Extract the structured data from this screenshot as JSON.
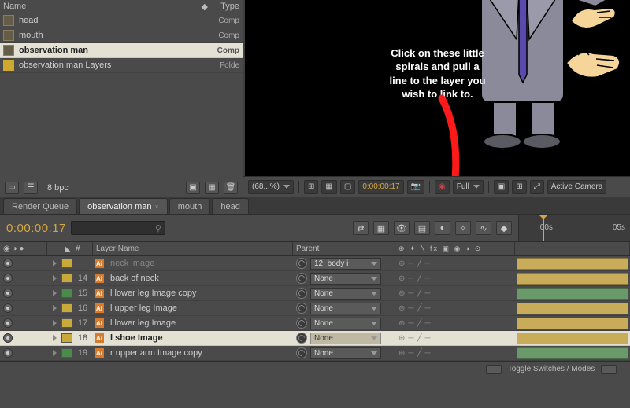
{
  "project": {
    "header_name": "Name",
    "header_type": "Type",
    "items": [
      {
        "name": "head",
        "type": "Comp",
        "kind": "comp",
        "sel": false
      },
      {
        "name": "mouth",
        "type": "Comp",
        "kind": "comp",
        "sel": false
      },
      {
        "name": "observation man",
        "type": "Comp",
        "kind": "comp",
        "sel": true
      },
      {
        "name": "observation man Layers",
        "type": "Folde",
        "kind": "folder",
        "sel": false
      }
    ],
    "footer_bpc": "8 bpc"
  },
  "viewer": {
    "annotation": "Click on these little\nspirals and pull a\nline to the layer you\nwish to link to.",
    "footer": {
      "zoom": "(68...%)",
      "timecode": "0:00:00:17",
      "res": "Full",
      "camera": "Active Camera"
    }
  },
  "tabs": [
    {
      "label": "Render Queue",
      "active": false
    },
    {
      "label": "observation man",
      "active": true,
      "close": true
    },
    {
      "label": "mouth",
      "active": false
    },
    {
      "label": "head",
      "active": false
    }
  ],
  "timeline": {
    "timecode": "0:00:00:17",
    "ruler_marks": [
      "",
      ":00s",
      "05s"
    ],
    "col_headers": {
      "num": "#",
      "layer": "Layer Name",
      "parent": "Parent"
    },
    "toggle_label": "Toggle Switches / Modes"
  },
  "layers": [
    {
      "num": "",
      "name": "neck image",
      "color": "y",
      "parent": "12. body i",
      "sel": false,
      "bar": "y",
      "dim": true
    },
    {
      "num": "14",
      "name": "back of neck",
      "color": "y",
      "parent": "None",
      "sel": false,
      "bar": "y"
    },
    {
      "num": "15",
      "name": "l lower leg Image copy",
      "color": "g",
      "parent": "None",
      "sel": false,
      "bar": "g"
    },
    {
      "num": "16",
      "name": "l upper leg Image",
      "color": "y",
      "parent": "None",
      "sel": false,
      "bar": "y"
    },
    {
      "num": "17",
      "name": "l lower leg Image",
      "color": "y",
      "parent": "None",
      "sel": false,
      "bar": "y"
    },
    {
      "num": "18",
      "name": "l shoe Image",
      "color": "y",
      "parent": "None",
      "sel": true,
      "bar": "y"
    },
    {
      "num": "19",
      "name": "r upper arm Image copy",
      "color": "g",
      "parent": "None",
      "sel": false,
      "bar": "g"
    }
  ],
  "icons": {
    "search": "⚲",
    "folder": "▣",
    "trash": "🗑",
    "new": "▦",
    "camera": "📷",
    "grid": "⊞",
    "mask": "▢",
    "expand": "⤢",
    "graph": "∿"
  }
}
